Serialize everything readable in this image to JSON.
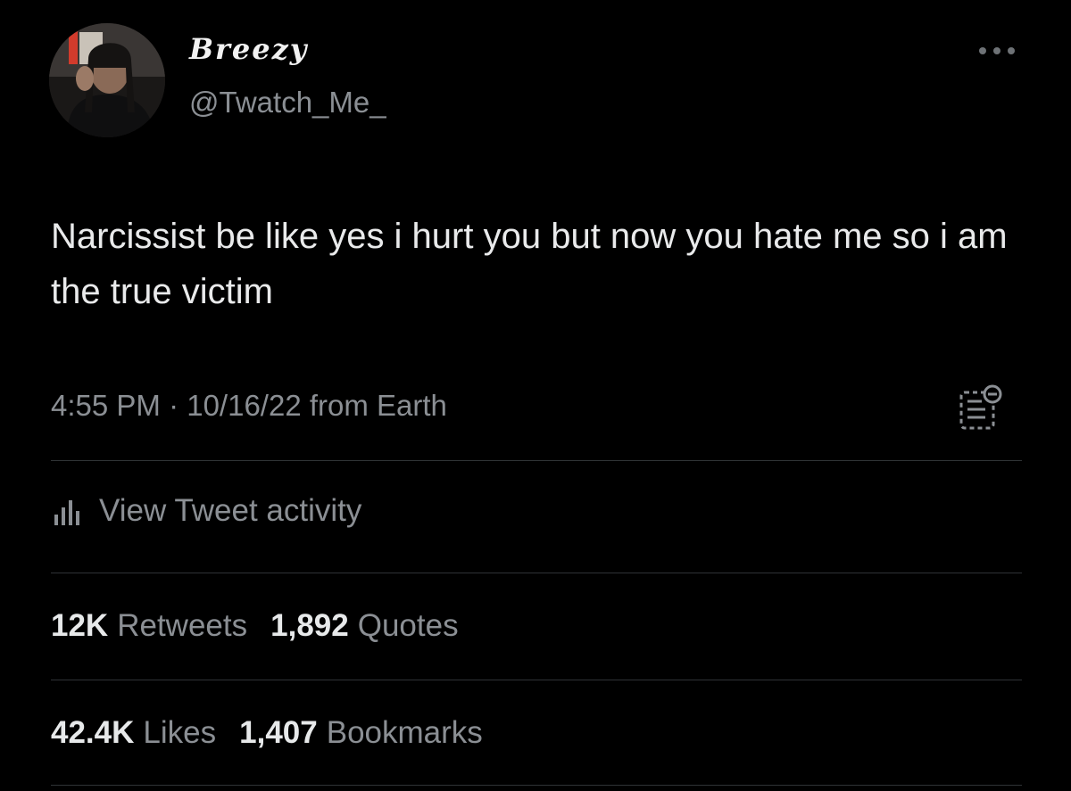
{
  "user": {
    "display_name": "Breezy",
    "handle": "@Twatch_Me_"
  },
  "tweet": {
    "text": "Narcissist be like yes i hurt you but now you hate me so i am the true victim",
    "meta": "4:55 PM · 10/16/22 from Earth"
  },
  "activity": {
    "label": "View Tweet activity",
    "icon": "bar-chart-icon"
  },
  "stats": {
    "retweets_count": "12K",
    "retweets_label": "Retweets",
    "quotes_count": "1,892",
    "quotes_label": "Quotes",
    "likes_count": "42.4K",
    "likes_label": "Likes",
    "bookmarks_count": "1,407",
    "bookmarks_label": "Bookmarks"
  },
  "icons": {
    "more": "more-options-icon",
    "notes": "community-note-icon"
  },
  "colors": {
    "background": "#000000",
    "text_primary": "#e7e9ea",
    "text_secondary": "#8b8f94",
    "divider": "#2f3336"
  }
}
